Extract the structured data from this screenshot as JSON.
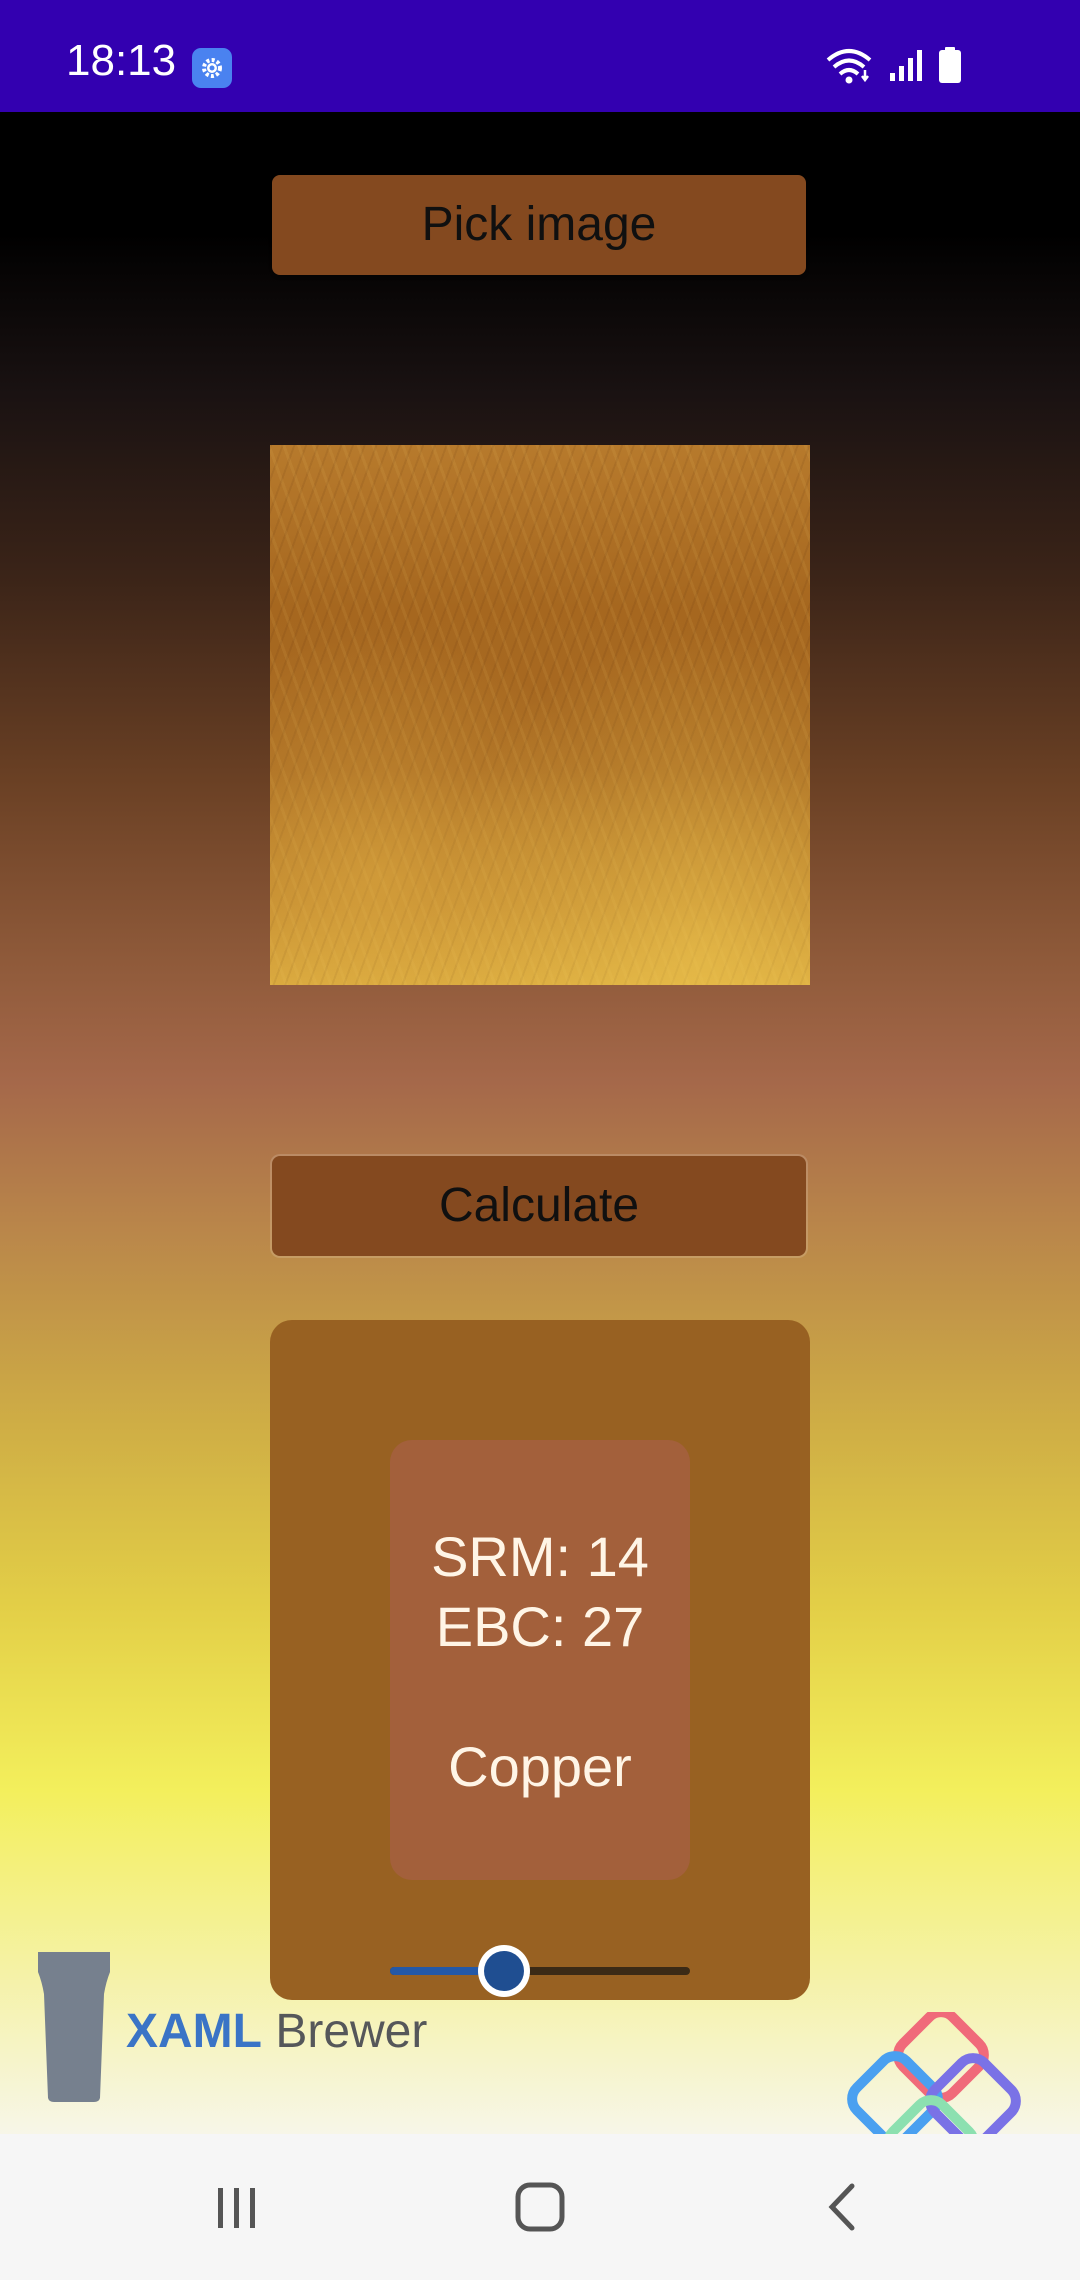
{
  "status_bar": {
    "time": "18:13",
    "icons": [
      "settings-icon",
      "wifi-icon",
      "signal-icon",
      "battery-icon"
    ],
    "color": "#3300b0"
  },
  "main": {
    "pick_button_label": "Pick image",
    "calculate_button_label": "Calculate",
    "result": {
      "srm_text": "SRM: 14",
      "ebc_text": "EBC: 27",
      "color_name": "Copper",
      "swatch_color": "#a3603b"
    },
    "slider": {
      "value": 0.38
    }
  },
  "brand": {
    "bold": "XAML",
    "light": " Brewer"
  },
  "nav_bar": {
    "icons": [
      "recents-icon",
      "home-icon",
      "back-icon"
    ]
  },
  "colors": {
    "button": "#84491f",
    "panel": "#986122",
    "accent": "#3a74c6"
  }
}
